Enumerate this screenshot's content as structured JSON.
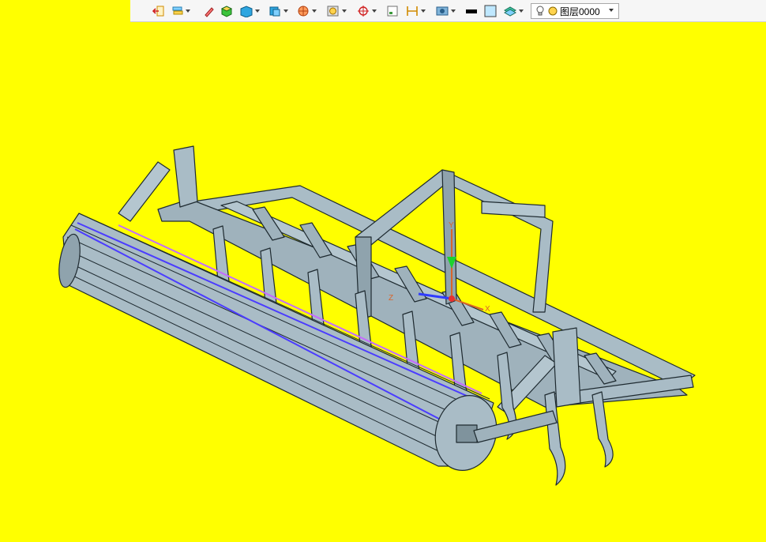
{
  "viewport": {
    "background_color": "#ffff00",
    "model_color": "#a9bcc6",
    "outline_color": "#1e2a30",
    "highlight_colors": [
      "#4b3cff",
      "#c46bff"
    ]
  },
  "toolbar": {
    "buttons": [
      {
        "name": "exit-sketch-icon",
        "has_dropdown": false
      },
      {
        "name": "layer-manager-icon",
        "has_dropdown": true
      },
      {
        "name": "pencil-icon",
        "has_dropdown": false
      },
      {
        "name": "solid-box-icon",
        "has_dropdown": false
      },
      {
        "name": "display-mode-icon",
        "has_dropdown": true
      },
      {
        "name": "view-orientation-icon",
        "has_dropdown": true
      },
      {
        "name": "section-view-icon",
        "has_dropdown": true
      },
      {
        "name": "render-mode-icon",
        "has_dropdown": true
      },
      {
        "name": "snap-target-icon",
        "has_dropdown": true
      },
      {
        "name": "sheet-icon",
        "has_dropdown": false
      },
      {
        "name": "dimension-icon",
        "has_dropdown": true
      },
      {
        "name": "image-capture-icon",
        "has_dropdown": true
      },
      {
        "name": "line-color-swatch",
        "has_dropdown": false
      },
      {
        "name": "face-color-swatch",
        "has_dropdown": false
      },
      {
        "name": "layer-stack-icon",
        "has_dropdown": true
      }
    ],
    "layer_selector": {
      "value": "图层0000",
      "lightbulb_icon": "lightbulb-icon",
      "status_icon": "layer-status-icon"
    }
  },
  "triad": {
    "labels": {
      "y": "Y",
      "x": "X",
      "z": "Z"
    },
    "colors": {
      "x": "#d9642a",
      "y": "#1bd22e",
      "z": "#2f3cff",
      "origin": "#e53030"
    }
  }
}
